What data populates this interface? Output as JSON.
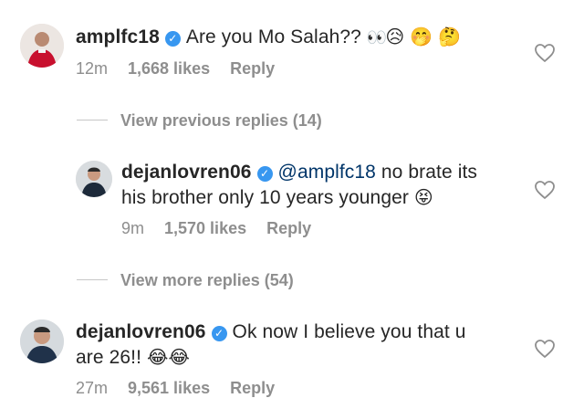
{
  "comments": [
    {
      "username": "amplfc18",
      "text": "Are you Mo Salah??",
      "emojis": [
        "eyes-icon",
        "sad-sweat-emoji",
        "hush-emoji",
        "thinking-emoji"
      ],
      "time": "12m",
      "likes": "1,668 likes",
      "reply": "Reply"
    },
    {
      "username": "dejanlovren06",
      "mention": "@amplfc18",
      "text_line1": "no brate its",
      "text_line2": "his brother only 10 years younger",
      "emojis": [
        "tongue-squint-emoji"
      ],
      "time": "9m",
      "likes": "1,570 likes",
      "reply": "Reply"
    },
    {
      "username": "dejanlovren06",
      "text_line1": "Ok now I believe you that u",
      "text_line2": "are 26!!",
      "emojis": [
        "tears-of-joy-emoji",
        "tears-of-joy-emoji"
      ],
      "time": "27m",
      "likes": "9,561 likes",
      "reply": "Reply"
    }
  ],
  "toggles": {
    "previous": "View previous replies (14)",
    "more": "View more replies (54)"
  },
  "colors": {
    "verified": "#3897f0",
    "meta": "#8e8e8e",
    "mention": "#003569",
    "text": "#262626"
  }
}
